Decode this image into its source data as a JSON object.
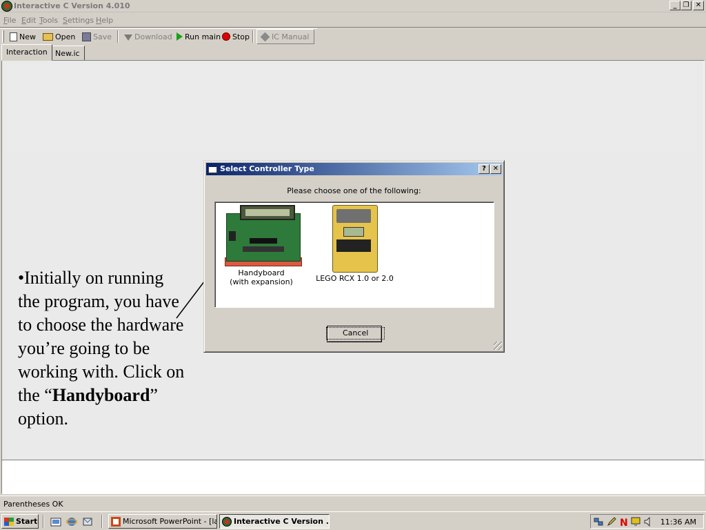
{
  "window": {
    "title": "Interactive C Version 4.010",
    "min_glyph": "_",
    "max_glyph": "❐",
    "close_glyph": "✕"
  },
  "menu": {
    "file": {
      "u": "F",
      "rest": "ile"
    },
    "edit": {
      "u": "E",
      "rest": "dit"
    },
    "tools": {
      "u": "T",
      "rest": "ools"
    },
    "settings": {
      "u": "S",
      "rest": "ettings"
    },
    "help": {
      "u": "H",
      "rest": "elp"
    }
  },
  "toolbar": {
    "new": "New",
    "open": "Open",
    "save": "Save",
    "download": "Download",
    "run_main": "Run main",
    "stop": "Stop",
    "ic_manual": "IC Manual"
  },
  "tabs": [
    {
      "label": "Interaction"
    },
    {
      "label": "New.ic"
    }
  ],
  "status": {
    "text": "Parentheses OK"
  },
  "instruction": {
    "part1": "•Initially on running the program, you have to choose the hardware you’re going to be working with. Click on the “",
    "bold": "Handyboard",
    "part2": "” option."
  },
  "dialog": {
    "title": "Select Controller Type",
    "help_glyph": "?",
    "close_glyph": "✕",
    "prompt": "Please choose one of the following:",
    "options": [
      {
        "label": "Handyboard\n(with expansion)"
      },
      {
        "label": "LEGO RCX 1.0 or 2.0"
      }
    ],
    "cancel": "Cancel"
  },
  "taskbar": {
    "start": "Start",
    "tasks": [
      {
        "label": "Microsoft PowerPoint - [la..."
      },
      {
        "label": "Interactive C Version ..."
      }
    ],
    "clock": "11:36 AM",
    "colors": {
      "stop_icon": "#e00000",
      "run_icon": "#1aa01a",
      "dialog_title": "#0a246a"
    }
  }
}
